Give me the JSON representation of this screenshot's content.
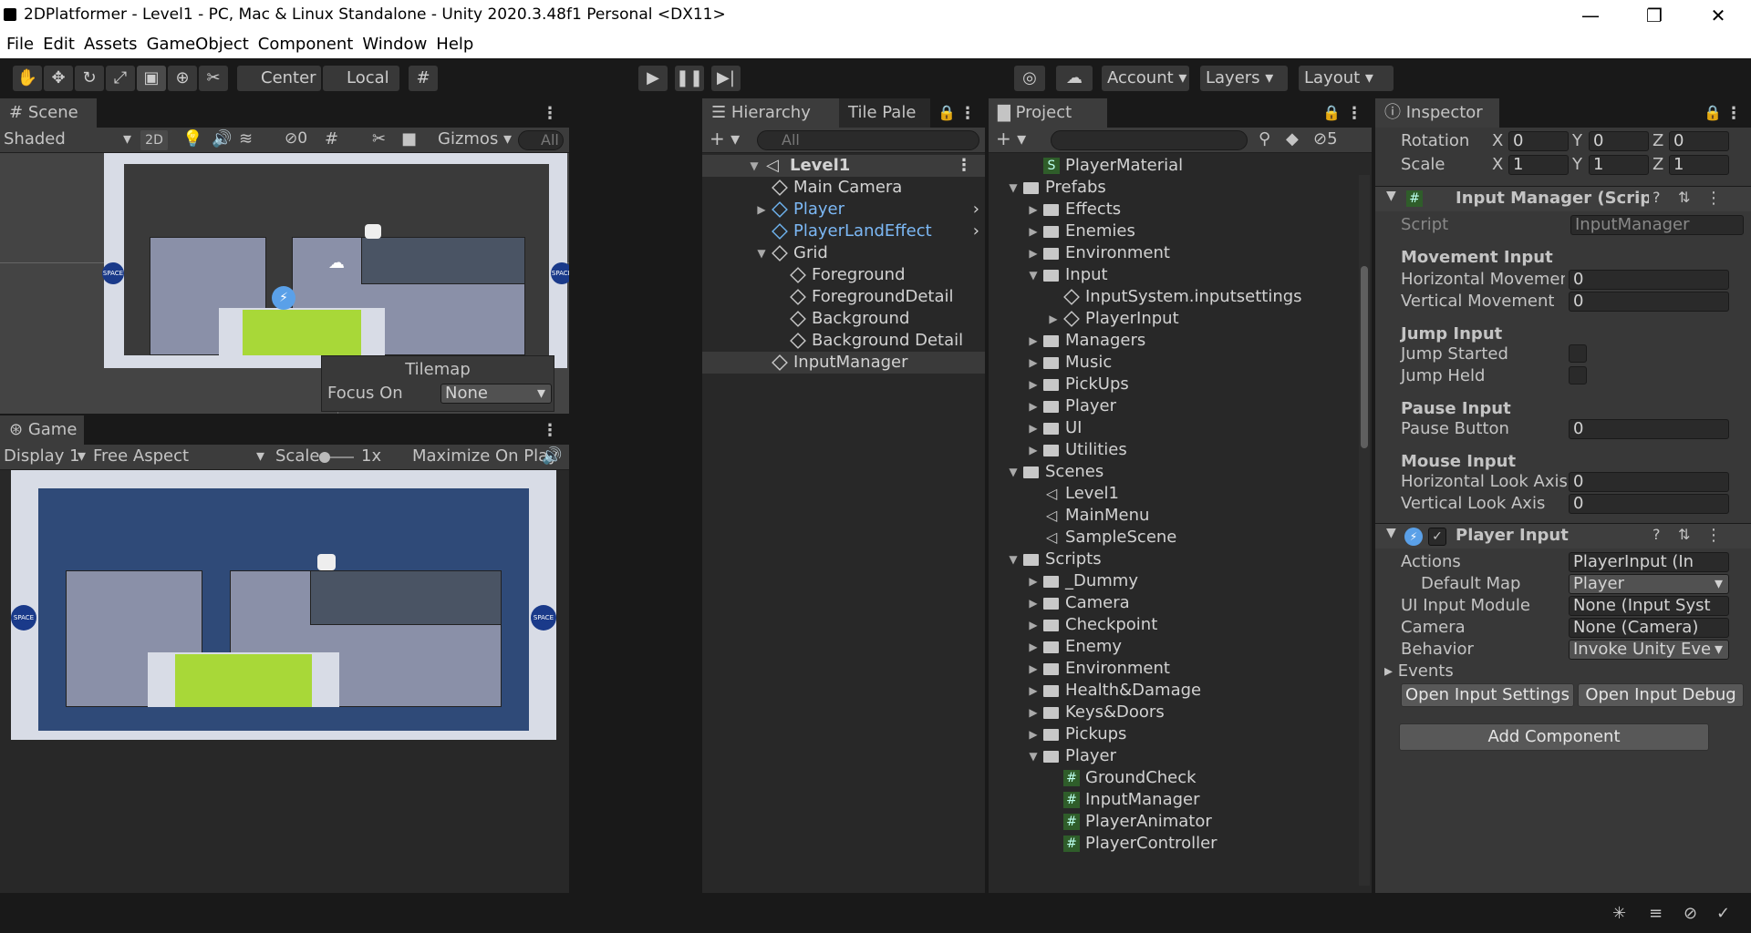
{
  "window": {
    "title": "2DPlatformer - Level1 - PC, Mac & Linux Standalone - Unity 2020.3.48f1 Personal <DX11>",
    "minimize": "—",
    "maximize": "❐",
    "close": "✕"
  },
  "menu": [
    "File",
    "Edit",
    "Assets",
    "GameObject",
    "Component",
    "Window",
    "Help"
  ],
  "toolbar": {
    "center": "Center",
    "local": "Local",
    "account": "Account",
    "layers": "Layers",
    "layout": "Layout"
  },
  "scene": {
    "tab": "Scene",
    "shading": "Shaded",
    "mode2d": "2D",
    "hidden_count": "0",
    "gizmos": "Gizmos",
    "search": "All",
    "tilemap": {
      "title": "Tilemap",
      "focus_label": "Focus On",
      "focus_value": "None"
    }
  },
  "game": {
    "tab": "Game",
    "display": "Display 1",
    "aspect": "Free Aspect",
    "scale_label": "Scale",
    "scale_value": "1x",
    "maximize": "Maximize On Play"
  },
  "hierarchy": {
    "tab": "Hierarchy",
    "tab2": "Tile Pale",
    "search": "All",
    "scene": "Level1",
    "items": [
      {
        "label": "Main Camera",
        "indent": 1,
        "blue": false,
        "arrow": ""
      },
      {
        "label": "Player",
        "indent": 1,
        "blue": true,
        "arrow": "▶"
      },
      {
        "label": "PlayerLandEffect",
        "indent": 1,
        "blue": true,
        "arrow": ""
      },
      {
        "label": "Grid",
        "indent": 1,
        "blue": false,
        "arrow": "▼"
      },
      {
        "label": "Foreground",
        "indent": 2,
        "blue": false,
        "arrow": ""
      },
      {
        "label": "ForegroundDetail",
        "indent": 2,
        "blue": false,
        "arrow": ""
      },
      {
        "label": "Background",
        "indent": 2,
        "blue": false,
        "arrow": ""
      },
      {
        "label": "Background Detail",
        "indent": 2,
        "blue": false,
        "arrow": ""
      },
      {
        "label": "InputManager",
        "indent": 1,
        "blue": false,
        "arrow": ""
      }
    ]
  },
  "project": {
    "tab": "Project",
    "hidden_count": "5",
    "items": [
      {
        "label": "PlayerMaterial",
        "indent": 2,
        "type": "mat",
        "arrow": ""
      },
      {
        "label": "Prefabs",
        "indent": 1,
        "type": "folder",
        "arrow": "▼"
      },
      {
        "label": "Effects",
        "indent": 2,
        "type": "folder",
        "arrow": "▶"
      },
      {
        "label": "Enemies",
        "indent": 2,
        "type": "folder",
        "arrow": "▶"
      },
      {
        "label": "Environment",
        "indent": 2,
        "type": "folder",
        "arrow": "▶"
      },
      {
        "label": "Input",
        "indent": 2,
        "type": "folder",
        "arrow": "▼"
      },
      {
        "label": "InputSystem.inputsettings",
        "indent": 3,
        "type": "cube",
        "arrow": ""
      },
      {
        "label": "PlayerInput",
        "indent": 3,
        "type": "cube",
        "arrow": "▶"
      },
      {
        "label": "Managers",
        "indent": 2,
        "type": "folder",
        "arrow": "▶"
      },
      {
        "label": "Music",
        "indent": 2,
        "type": "folder",
        "arrow": "▶"
      },
      {
        "label": "PickUps",
        "indent": 2,
        "type": "folder",
        "arrow": "▶"
      },
      {
        "label": "Player",
        "indent": 2,
        "type": "folder",
        "arrow": "▶"
      },
      {
        "label": "UI",
        "indent": 2,
        "type": "folder",
        "arrow": "▶"
      },
      {
        "label": "Utilities",
        "indent": 2,
        "type": "folder",
        "arrow": "▶"
      },
      {
        "label": "Scenes",
        "indent": 1,
        "type": "folder",
        "arrow": "▼"
      },
      {
        "label": "Level1",
        "indent": 2,
        "type": "unity",
        "arrow": ""
      },
      {
        "label": "MainMenu",
        "indent": 2,
        "type": "unity",
        "arrow": ""
      },
      {
        "label": "SampleScene",
        "indent": 2,
        "type": "unity",
        "arrow": ""
      },
      {
        "label": "Scripts",
        "indent": 1,
        "type": "folder",
        "arrow": "▼"
      },
      {
        "label": "_Dummy",
        "indent": 2,
        "type": "folder",
        "arrow": "▶"
      },
      {
        "label": "Camera",
        "indent": 2,
        "type": "folder",
        "arrow": "▶"
      },
      {
        "label": "Checkpoint",
        "indent": 2,
        "type": "folder",
        "arrow": "▶"
      },
      {
        "label": "Enemy",
        "indent": 2,
        "type": "folder",
        "arrow": "▶"
      },
      {
        "label": "Environment",
        "indent": 2,
        "type": "folder",
        "arrow": "▶"
      },
      {
        "label": "Health&Damage",
        "indent": 2,
        "type": "folder",
        "arrow": "▶"
      },
      {
        "label": "Keys&Doors",
        "indent": 2,
        "type": "folder",
        "arrow": "▶"
      },
      {
        "label": "Pickups",
        "indent": 2,
        "type": "folder",
        "arrow": "▶"
      },
      {
        "label": "Player",
        "indent": 2,
        "type": "folder",
        "arrow": "▼"
      },
      {
        "label": "GroundCheck",
        "indent": 3,
        "type": "script",
        "arrow": ""
      },
      {
        "label": "InputManager",
        "indent": 3,
        "type": "script",
        "arrow": ""
      },
      {
        "label": "PlayerAnimator",
        "indent": 3,
        "type": "script",
        "arrow": ""
      },
      {
        "label": "PlayerController",
        "indent": 3,
        "type": "script",
        "arrow": ""
      }
    ]
  },
  "inspector": {
    "tab": "Inspector",
    "rotation": {
      "label": "Rotation",
      "x": "0",
      "y": "0",
      "z": "0"
    },
    "scale": {
      "label": "Scale",
      "x": "1",
      "y": "1",
      "z": "1"
    },
    "axis": {
      "x": "X",
      "y": "Y",
      "z": "Z"
    },
    "input_manager": {
      "title": "Input Manager (Script)",
      "script_label": "Script",
      "script_value": "InputManager",
      "movement": "Movement Input",
      "h_move_label": "Horizontal Movemen",
      "h_move": "0",
      "v_move_label": "Vertical Movement",
      "v_move": "0",
      "jump": "Jump Input",
      "jump_started": "Jump Started",
      "jump_held": "Jump Held",
      "pause": "Pause Input",
      "pause_button": "Pause Button",
      "pause_value": "0",
      "mouse": "Mouse Input",
      "h_look": "Horizontal Look Axis",
      "h_look_value": "0",
      "v_look": "Vertical Look Axis",
      "v_look_value": "0"
    },
    "player_input": {
      "title": "Player Input",
      "actions_label": "Actions",
      "actions": "PlayerInput (In",
      "default_map_label": "Default Map",
      "default_map": "Player",
      "ui_module_label": "UI Input Module",
      "ui_module": "None (Input Syst",
      "camera_label": "Camera",
      "camera": "None (Camera)",
      "behavior_label": "Behavior",
      "behavior": "Invoke Unity Eve",
      "events": "Events",
      "open_settings": "Open Input Settings",
      "open_debug": "Open Input Debug"
    },
    "add_component": "Add Component"
  }
}
